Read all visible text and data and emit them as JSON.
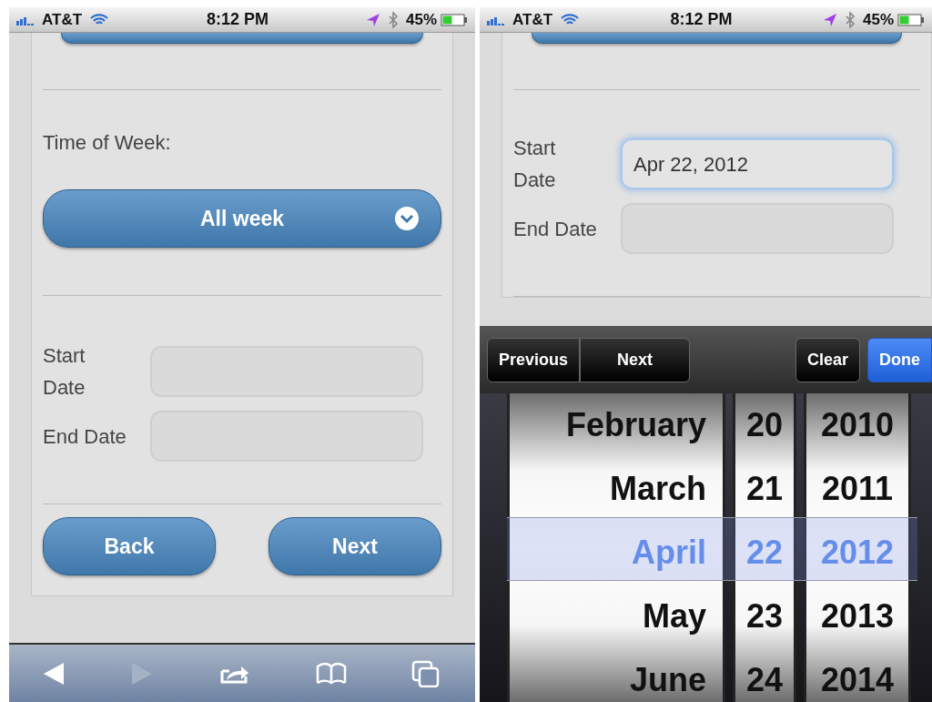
{
  "screens": [
    {
      "status_bar": {
        "carrier": "AT&T",
        "time": "8:12 PM",
        "battery": "45%"
      },
      "form": {
        "section_label": "Time of Week:",
        "select_value": "All week",
        "fields": [
          {
            "label": "Start Date",
            "focused": false
          },
          {
            "label": "End Date",
            "focused": false
          }
        ],
        "buttons": [
          "Back",
          "Next"
        ]
      },
      "toolbar": {
        "back_enabled": true,
        "forward_enabled": false
      }
    },
    {
      "status_bar": {
        "carrier": "AT&T",
        "time": "8:12 PM",
        "battery": "45%"
      },
      "form": {
        "fields": [
          {
            "label": "Start Date",
            "value": "Apr 22, 2012",
            "focused": true
          },
          {
            "label": "End Date",
            "focused": false
          }
        ]
      },
      "accessory_bar": {
        "nav_buttons": [
          "Previous",
          "Next"
        ],
        "clear": "Clear",
        "done": "Done"
      },
      "picker": {
        "columns": [
          {
            "kind": "month",
            "items": [
              {
                "text": "February",
                "selected": false
              },
              {
                "text": "March",
                "selected": false
              },
              {
                "text": "April",
                "selected": true
              },
              {
                "text": "May",
                "selected": false
              },
              {
                "text": "June",
                "selected": false
              }
            ]
          },
          {
            "kind": "day",
            "items": [
              {
                "text": "20",
                "selected": false
              },
              {
                "text": "21",
                "selected": false
              },
              {
                "text": "22",
                "selected": true
              },
              {
                "text": "23",
                "selected": false
              },
              {
                "text": "24",
                "selected": false
              }
            ]
          },
          {
            "kind": "year",
            "items": [
              {
                "text": "2010",
                "selected": false
              },
              {
                "text": "2011",
                "selected": false
              },
              {
                "text": "2012",
                "selected": true
              },
              {
                "text": "2013",
                "selected": false
              },
              {
                "text": "2014",
                "selected": false
              }
            ]
          }
        ]
      }
    }
  ]
}
